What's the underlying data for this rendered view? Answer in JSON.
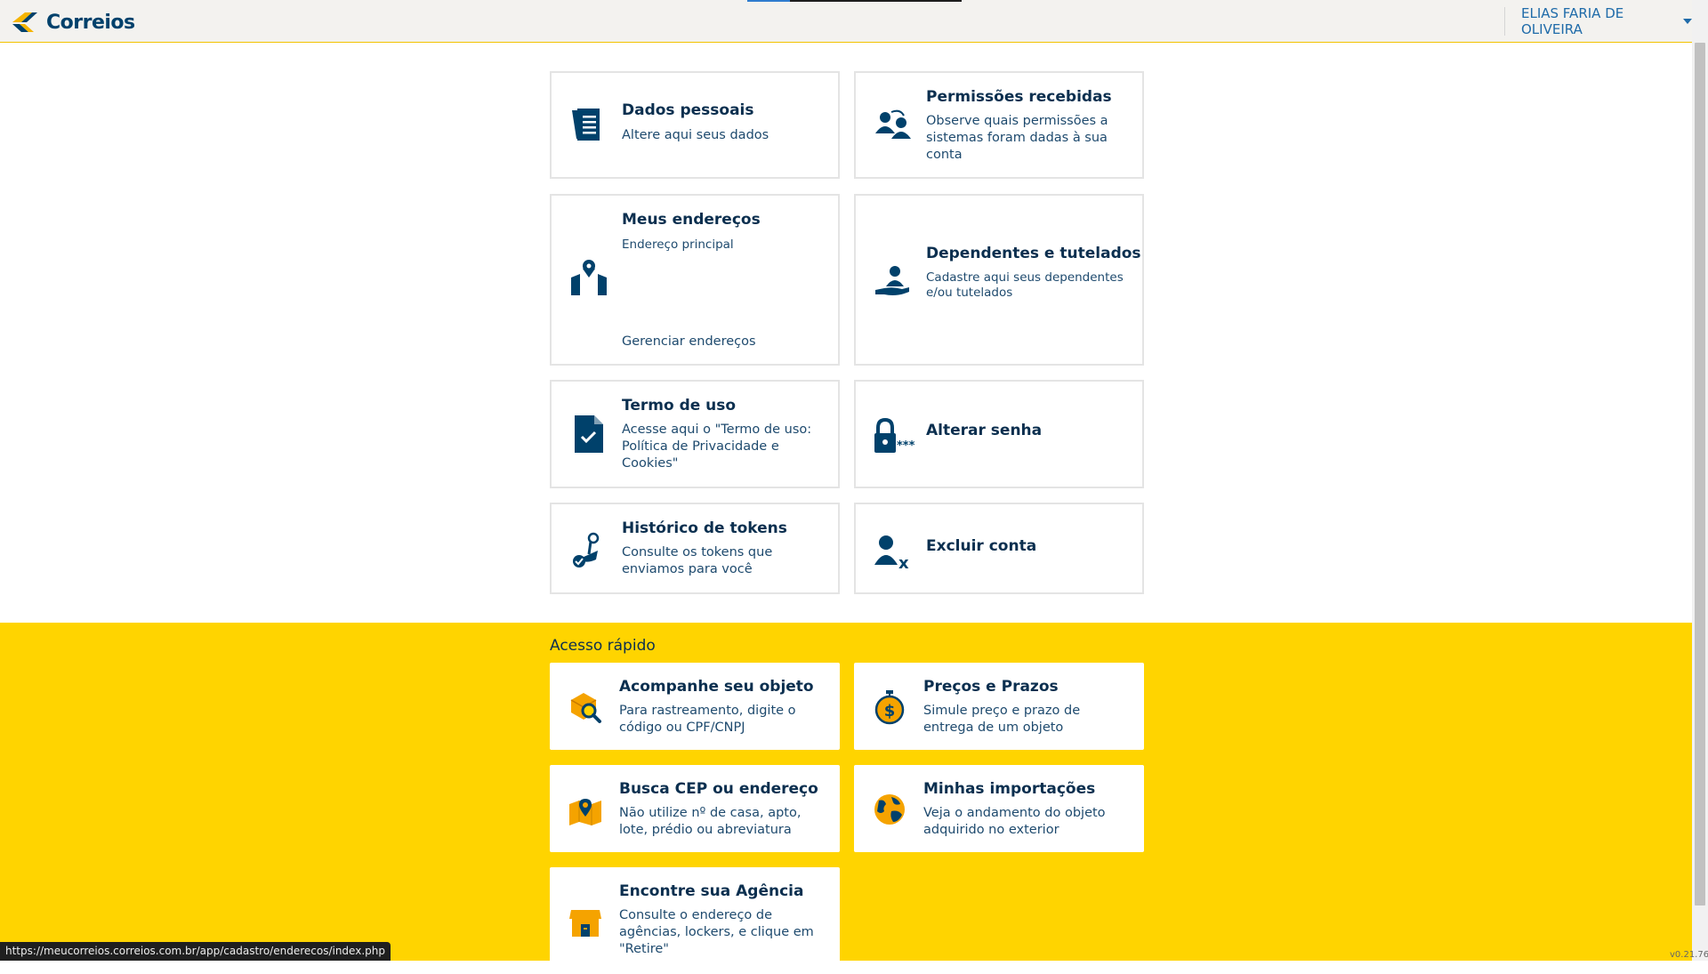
{
  "header": {
    "brand": "Correios",
    "user_name": "ELIAS FARIA DE OLIVEIRA"
  },
  "cards": {
    "dados": {
      "title": "Dados pessoais",
      "desc": "Altere aqui seus dados",
      "icon": "document-list-icon"
    },
    "permissoes": {
      "title": "Permissões recebidas",
      "desc1": "Observe quais permissões a",
      "desc2": "sistemas foram dadas à sua",
      "desc3": "conta",
      "icon": "users-permissions-icon"
    },
    "enderecos": {
      "title": "Meus endereços",
      "desc": "Endereço principal",
      "link": "Gerenciar endereços",
      "icon": "house-pin-icon"
    },
    "dependentes": {
      "title": "Dependentes e tutelados",
      "desc1": "Cadastre aqui seus dependentes",
      "desc2": "e/ou tutelados",
      "icon": "hand-person-icon"
    },
    "termo": {
      "title": "Termo de uso",
      "desc1": "Acesse aqui o \"Termo de uso:",
      "desc2": "Política de Privacidade e",
      "desc3": "Cookies\"",
      "icon": "document-check-icon"
    },
    "senha": {
      "title": "Alterar senha",
      "icon": "lock-password-icon",
      "mask": "***"
    },
    "tokens": {
      "title": "Histórico de tokens",
      "desc1": "Consulte os tokens que",
      "desc2": "enviamos para você",
      "icon": "token-history-icon"
    },
    "excluir": {
      "title": "Excluir conta",
      "icon": "user-remove-icon",
      "mark": "x"
    }
  },
  "quick": {
    "title": "Acesso rápido",
    "items": [
      {
        "title": "Acompanhe seu objeto",
        "desc1": "Para rastreamento, digite o",
        "desc2": "código ou CPF/CNPJ",
        "icon": "package-search-icon"
      },
      {
        "title": "Preços e Prazos",
        "desc1": "Simule preço e prazo de",
        "desc2": "entrega de um objeto",
        "icon": "money-timer-icon",
        "symbol": "$"
      },
      {
        "title": "Busca CEP ou endereço",
        "desc1": "Não utilize nº de casa, apto,",
        "desc2": "lote, prédio ou abreviatura",
        "icon": "map-pin-icon"
      },
      {
        "title": "Minhas importações",
        "desc1": "Veja o andamento do objeto",
        "desc2": "adquirido no exterior",
        "icon": "globe-icon"
      },
      {
        "title": "Encontre sua Agência",
        "desc1": "Consulte o endereço de",
        "desc2": "agências, lockers, e clique em",
        "desc3": "\"Retire\"",
        "icon": "agency-store-icon"
      }
    ]
  },
  "status_url": "https://meucorreios.correios.com.br/app/cadastro/enderecos/index.php",
  "version": "v0.21.76",
  "colors": {
    "brand_blue": "#00416b",
    "brand_yellow": "#ffd400",
    "accent_blue": "#1f6ba9"
  }
}
